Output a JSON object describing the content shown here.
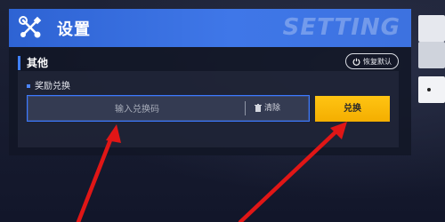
{
  "header": {
    "title": "设置",
    "watermark_text": "SETTING",
    "icon": "wrench-screwdriver-icon"
  },
  "section": {
    "title": "其他",
    "restore_button": "恢复默认",
    "restore_icon": "power-icon"
  },
  "reward": {
    "title": "奖励兑换",
    "input_placeholder": "输入兑换码",
    "input_value": "",
    "clear_label": "清除",
    "clear_icon": "trash-icon",
    "redeem_label": "兑换"
  },
  "colors": {
    "header_blue": "#3f77e8",
    "accent_blue": "#3b79ff",
    "redeem_yellow": "#f4ae00",
    "arrow_red": "#e01616"
  }
}
